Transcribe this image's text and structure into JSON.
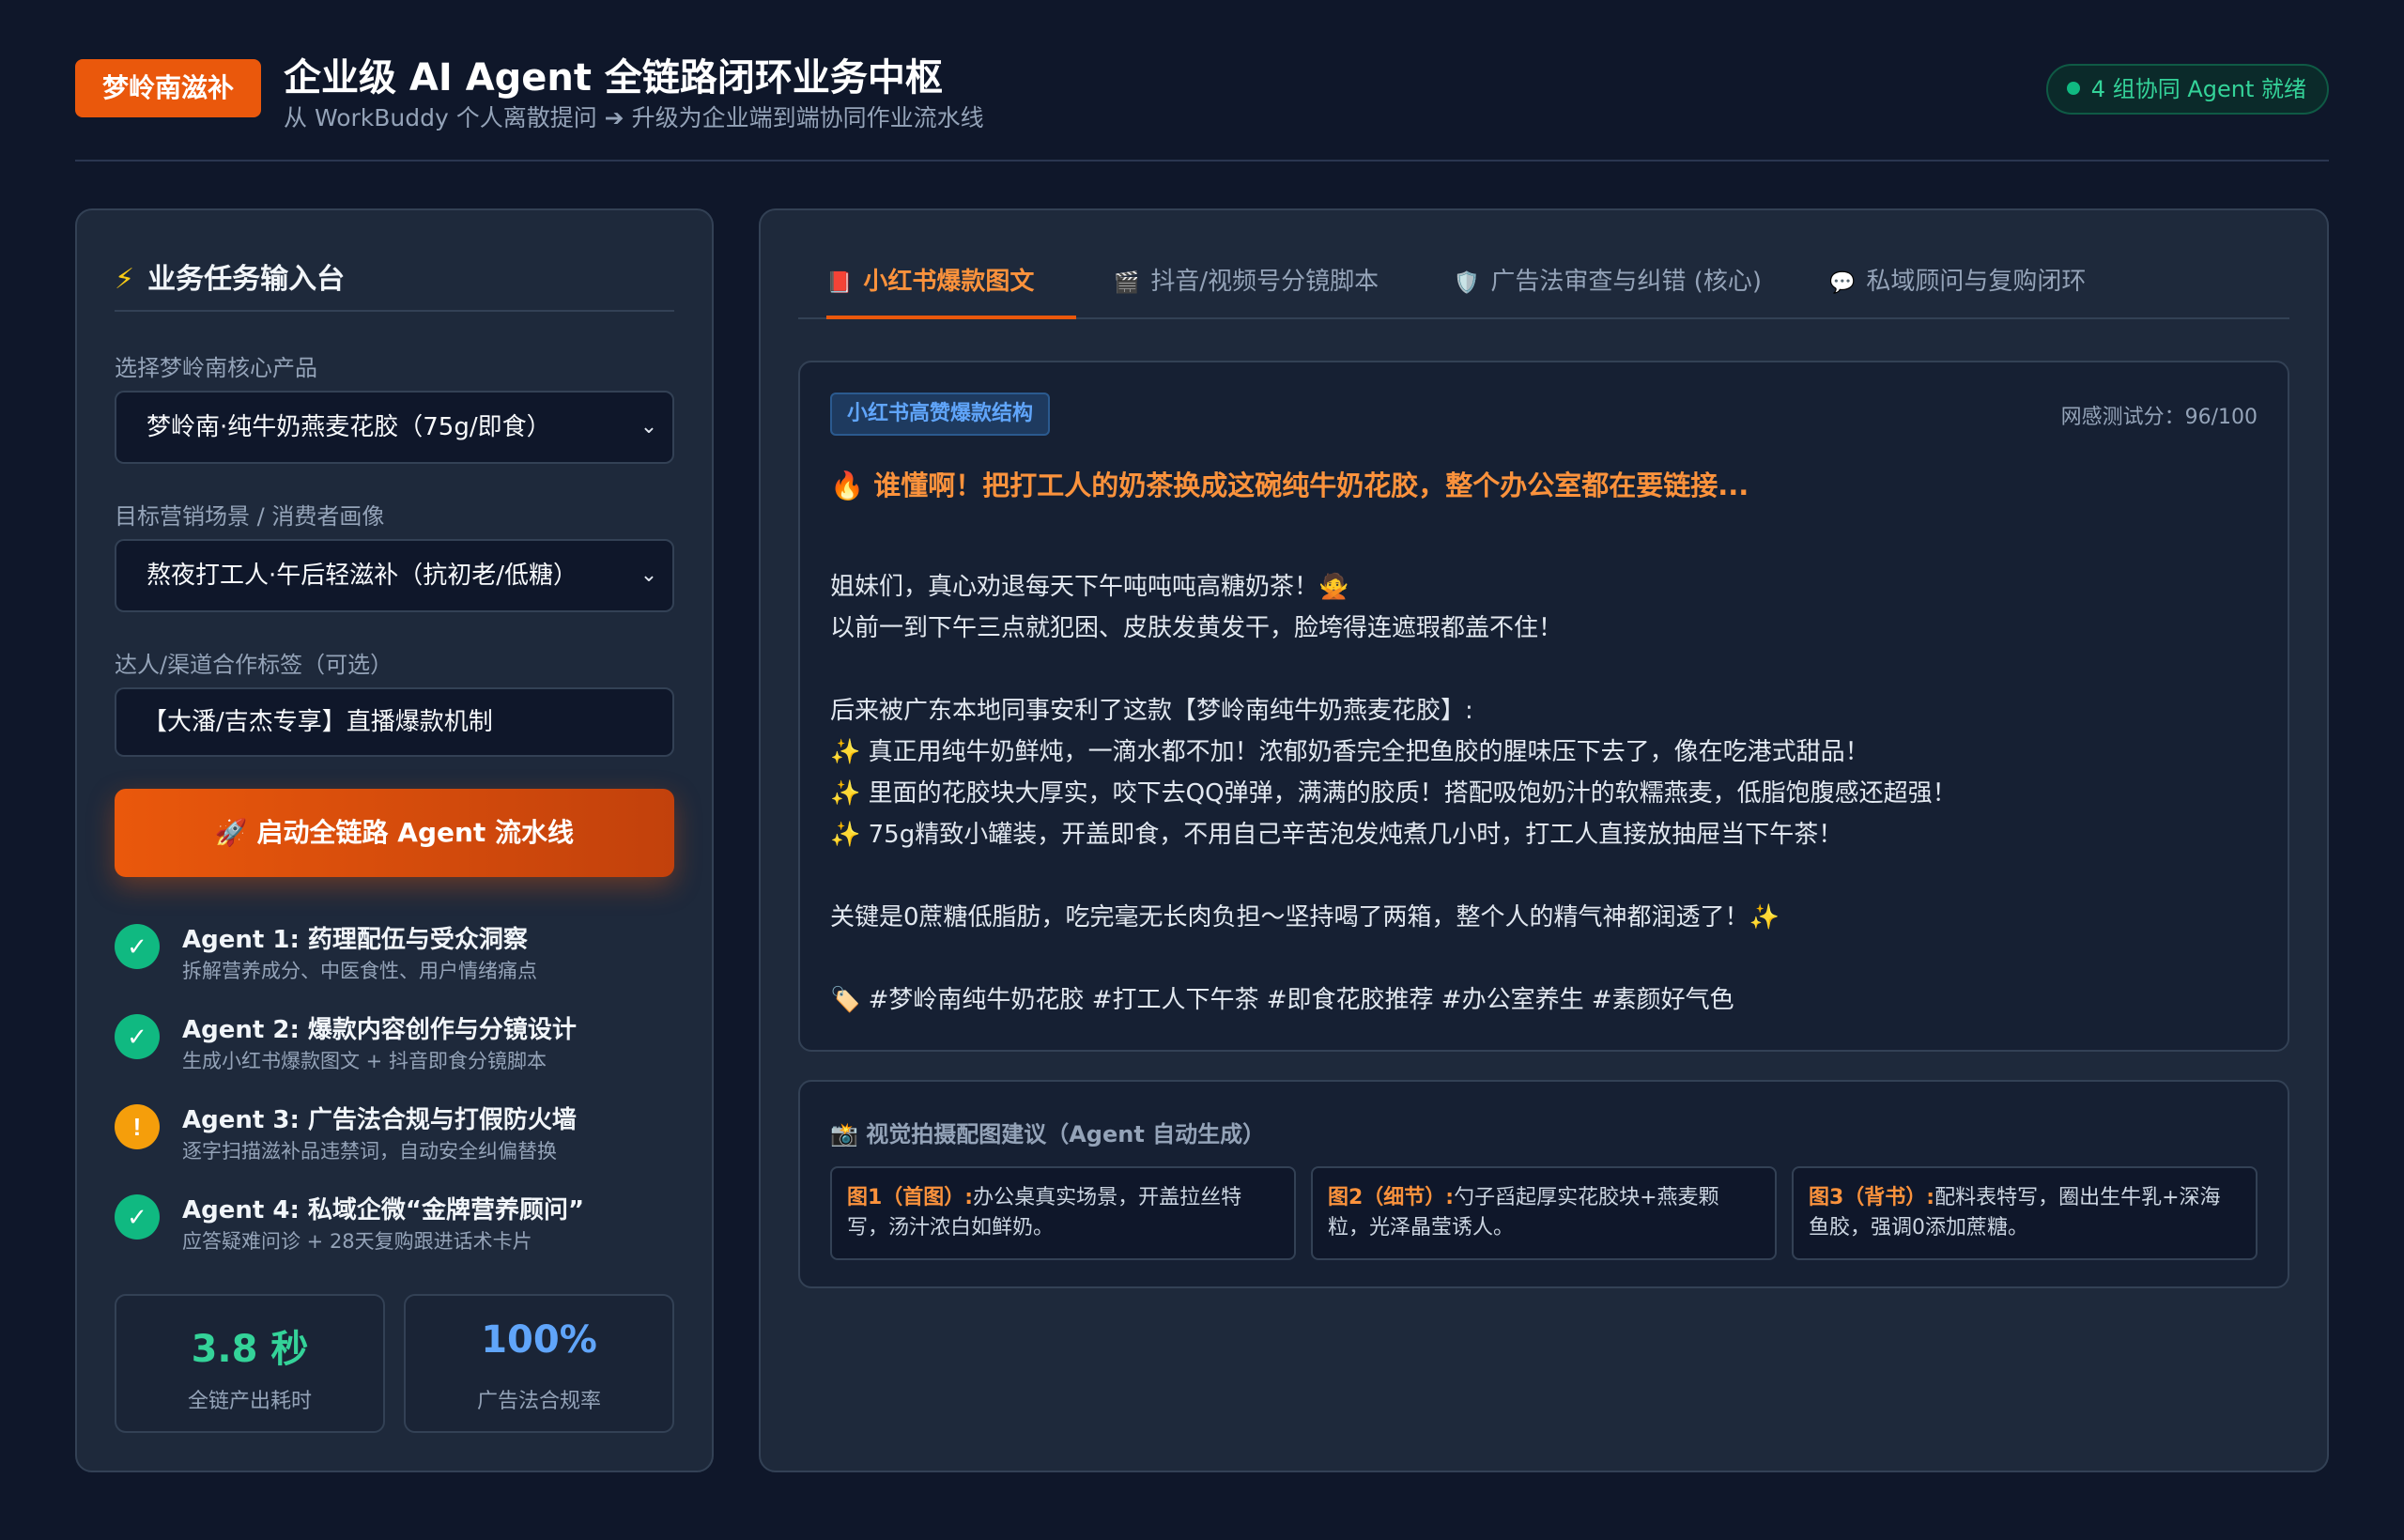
{
  "header": {
    "brand": "梦岭南滋补",
    "title": "企业级 AI Agent 全链路闭环业务中枢",
    "subtitle": "从 WorkBuddy 个人离散提问 ➔ 升级为企业端到端协同作业流水线",
    "status": "4 组协同 Agent 就绪"
  },
  "input_panel": {
    "title": "业务任务输入台",
    "product_label": "选择梦岭南核心产品",
    "product_value": "梦岭南·纯牛奶燕麦花胶（75g/即食）",
    "scenario_label": "目标营销场景 / 消费者画像",
    "scenario_value": "熬夜打工人·午后轻滋补（抗初老/低糖）",
    "channel_label": "达人/渠道合作标签（可选）",
    "channel_value": "【大潘/吉杰专享】直播爆款机制",
    "launch_button": "🚀 启动全链路 Agent 流水线",
    "agents": [
      {
        "status": "done",
        "icon": "✓",
        "title": "Agent 1: 药理配伍与受众洞察",
        "desc": "拆解营养成分、中医食性、用户情绪痛点"
      },
      {
        "status": "done",
        "icon": "✓",
        "title": "Agent 2: 爆款内容创作与分镜设计",
        "desc": "生成小红书爆款图文 + 抖音即食分镜脚本"
      },
      {
        "status": "warning",
        "icon": "!",
        "title": "Agent 3: 广告法合规与打假防火墙",
        "desc": "逐字扫描滋补品违禁词，自动安全纠偏替换"
      },
      {
        "status": "done",
        "icon": "✓",
        "title": "Agent 4: 私域企微“金牌营养顾问”",
        "desc": "应答疑难问诊 + 28天复购跟进话术卡片"
      }
    ],
    "stats": [
      {
        "value": "3.8 秒",
        "label": "全链产出耗时",
        "color": "#34d399"
      },
      {
        "value": "100%",
        "label": "广告法合规率",
        "color": "#60a5fa"
      }
    ]
  },
  "tabs": [
    {
      "icon": "📕",
      "label": "小红书爆款图文",
      "active": true
    },
    {
      "icon": "🎬",
      "label": "抖音/视频号分镜脚本",
      "active": false
    },
    {
      "icon": "🛡️",
      "label": "广告法审查与纠错 (核心)",
      "active": false
    },
    {
      "icon": "💬",
      "label": "私域顾问与复购闭环",
      "active": false
    }
  ],
  "post": {
    "tag": "小红书高赞爆款结构",
    "score": "网感测试分：96/100",
    "headline": "🔥 谁懂啊！把打工人的奶茶换成这碗纯牛奶花胶，整个办公室都在要链接...",
    "lines": [
      "姐妹们，真心劝退每天下午吨吨吨高糖奶茶！🙅",
      "以前一到下午三点就犯困、皮肤发黄发干，脸垮得连遮瑕都盖不住！",
      "",
      "后来被广东本地同事安利了这款【梦岭南纯牛奶燕麦花胶】:",
      "✨ 真正用纯牛奶鲜炖，一滴水都不加！浓郁奶香完全把鱼胶的腥味压下去了，像在吃港式甜品！",
      "✨ 里面的花胶块大厚实，咬下去QQ弹弹，满满的胶质！搭配吸饱奶汁的软糯燕麦，低脂饱腹感还超强！",
      "✨ 75g精致小罐装，开盖即食，不用自己辛苦泡发炖煮几小时，打工人直接放抽屉当下午茶！",
      "",
      "关键是0蔗糖低脂肪，吃完毫无长肉负担～坚持喝了两箱，整个人的精气神都润透了！✨",
      "",
      "🏷️ #梦岭南纯牛奶花胶 #打工人下午茶 #即食花胶推荐 #办公室养生 #素颜好气色"
    ]
  },
  "visuals": {
    "title": "📸 视觉拍摄配图建议（Agent 自动生成）",
    "items": [
      {
        "label": "图1（首图）:",
        "text": "办公桌真实场景，开盖拉丝特写，汤汁浓白如鲜奶。"
      },
      {
        "label": "图2（细节）:",
        "text": "勺子舀起厚实花胶块+燕麦颗粒，光泽晶莹诱人。"
      },
      {
        "label": "图3（背书）:",
        "text": "配料表特写，圈出生牛乳+深海鱼胶，强调0添加蔗糖。"
      }
    ]
  }
}
